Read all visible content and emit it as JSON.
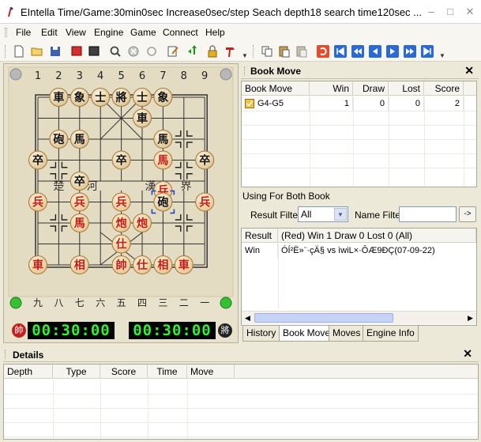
{
  "window": {
    "title": "EIntella Time/Game:30min0sec Increase0sec/step Seach depth18 search time120sec ...",
    "minimize": "–",
    "maximize": "□",
    "close": "✕"
  },
  "menu": [
    "File",
    "Edit",
    "View",
    "Engine",
    "Game",
    "Connect",
    "Help"
  ],
  "toolbar": {
    "icons": [
      "new-file-icon",
      "open-folder-icon",
      "save-icon",
      "red-board-icon",
      "black-board-icon",
      "search-icon",
      "stop-icon",
      "refresh-icon",
      "edit-icon",
      "move-icon",
      "lock-icon",
      "hammer-icon",
      "copy-icon",
      "paste-icon",
      "paste-special-icon",
      "undo-icon",
      "first-move-icon",
      "prev-fast-icon",
      "prev-move-icon",
      "next-move-icon",
      "next-fast-icon",
      "last-move-icon"
    ]
  },
  "board": {
    "top_coords": [
      "1",
      "2",
      "3",
      "4",
      "5",
      "6",
      "7",
      "8",
      "9"
    ],
    "bottom_coords": [
      "九",
      "八",
      "七",
      "六",
      "五",
      "四",
      "三",
      "二",
      "一"
    ],
    "river_left": [
      "楚",
      "河"
    ],
    "river_right": [
      "漢",
      "界"
    ],
    "pieces": [
      {
        "side": "black",
        "char": "車",
        "file": 1,
        "rank": 0
      },
      {
        "side": "black",
        "char": "象",
        "file": 2,
        "rank": 0
      },
      {
        "side": "black",
        "char": "士",
        "file": 3,
        "rank": 0
      },
      {
        "side": "black",
        "char": "將",
        "file": 4,
        "rank": 0
      },
      {
        "side": "black",
        "char": "士",
        "file": 5,
        "rank": 0
      },
      {
        "side": "black",
        "char": "象",
        "file": 6,
        "rank": 0
      },
      {
        "side": "black",
        "char": "車",
        "file": 5,
        "rank": 1
      },
      {
        "side": "black",
        "char": "砲",
        "file": 1,
        "rank": 2
      },
      {
        "side": "black",
        "char": "馬",
        "file": 2,
        "rank": 2
      },
      {
        "side": "black",
        "char": "馬",
        "file": 6,
        "rank": 2
      },
      {
        "side": "black",
        "char": "卒",
        "file": 0,
        "rank": 3
      },
      {
        "side": "black",
        "char": "卒",
        "file": 4,
        "rank": 3
      },
      {
        "side": "black",
        "char": "卒",
        "file": 8,
        "rank": 3
      },
      {
        "side": "red",
        "char": "馬",
        "file": 6,
        "rank": 3
      },
      {
        "side": "black",
        "char": "卒",
        "file": 2,
        "rank": 4
      },
      {
        "side": "red",
        "char": "兵",
        "file": 6,
        "rank": 4.45
      },
      {
        "side": "red",
        "char": "兵",
        "file": 0,
        "rank": 5
      },
      {
        "side": "red",
        "char": "兵",
        "file": 2,
        "rank": 5
      },
      {
        "side": "red",
        "char": "兵",
        "file": 4,
        "rank": 5
      },
      {
        "side": "black",
        "char": "砲",
        "file": 6,
        "rank": 5,
        "selected": true
      },
      {
        "side": "red",
        "char": "兵",
        "file": 8,
        "rank": 5
      },
      {
        "side": "red",
        "char": "馬",
        "file": 2,
        "rank": 6
      },
      {
        "side": "red",
        "char": "炮",
        "file": 4,
        "rank": 6
      },
      {
        "side": "red",
        "char": "炮",
        "file": 5,
        "rank": 6
      },
      {
        "side": "red",
        "char": "仕",
        "file": 4,
        "rank": 7
      },
      {
        "side": "red",
        "char": "車",
        "file": 0,
        "rank": 8
      },
      {
        "side": "red",
        "char": "相",
        "file": 2,
        "rank": 8
      },
      {
        "side": "red",
        "char": "帥",
        "file": 4,
        "rank": 8
      },
      {
        "side": "red",
        "char": "仕",
        "file": 5,
        "rank": 8
      },
      {
        "side": "red",
        "char": "相",
        "file": 6,
        "rank": 8
      },
      {
        "side": "red",
        "char": "車",
        "file": 7,
        "rank": 8
      }
    ],
    "markers": [
      {
        "file": 1,
        "rank": 3.5
      },
      {
        "file": 7,
        "rank": 3.5
      },
      {
        "file": 7,
        "rank": 2
      },
      {
        "file": 1,
        "rank": 6
      },
      {
        "file": 7,
        "rank": 6
      }
    ]
  },
  "clocks": {
    "red_icon": "帥",
    "black_icon": "將",
    "red_time": "00:30:00",
    "black_time": "00:30:00"
  },
  "book_move": {
    "title": "Book Move",
    "columns": [
      "Book Move",
      "Win",
      "Draw",
      "Lost",
      "Score"
    ],
    "rows": [
      {
        "move": "G4-G5",
        "win": "1",
        "draw": "0",
        "lost": "0",
        "score": "2"
      }
    ],
    "using_label": "Using For Both Book",
    "result_filter_label": "Result Filter",
    "result_filter_value": "All",
    "name_filter_label": "Name Filter",
    "name_filter_value": "",
    "go_button": "->"
  },
  "games": {
    "columns": [
      "Result",
      "(Red) Win 1 Draw 0 Lost 0 (All)"
    ],
    "rows": [
      {
        "result": "Win",
        "game": "ÓÍ²Ë»¨·çÄ§ vs ìwiL×·ÔÆ9ÐÇ(07-09-22)"
      }
    ]
  },
  "tabs": [
    "History",
    "Book Move",
    "Moves",
    "Engine Info"
  ],
  "active_tab": 1,
  "details": {
    "title": "Details",
    "columns": [
      "Depth",
      "Type",
      "Score",
      "Time",
      "Move"
    ]
  }
}
